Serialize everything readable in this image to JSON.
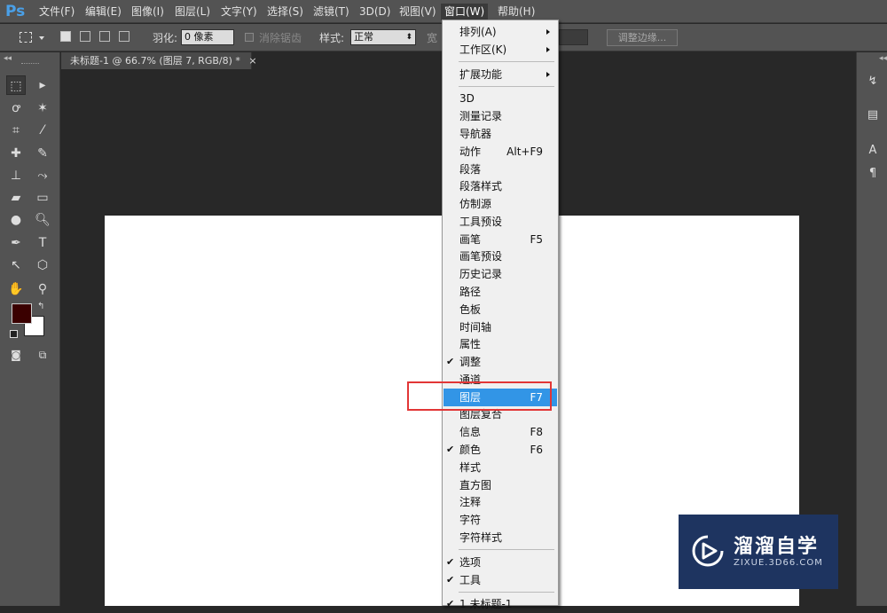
{
  "app": {
    "logo": "Ps"
  },
  "menubar": [
    "文件(F)",
    "编辑(E)",
    "图像(I)",
    "图层(L)",
    "文字(Y)",
    "选择(S)",
    "滤镜(T)",
    "3D(D)",
    "视图(V)",
    "窗口(W)",
    "帮助(H)"
  ],
  "options": {
    "feather_label": "羽化:",
    "feather_value": "0 像素",
    "antialias_label": "消除锯齿",
    "style_label": "样式:",
    "style_value": "正常",
    "width_label": "宽",
    "refine_button": "调整边缘..."
  },
  "document": {
    "tab_title": "未标题-1 @ 66.7% (图层 7, RGB/8) *",
    "close": "×"
  },
  "window_menu": {
    "items": [
      {
        "label": "排列(A)",
        "submenu": true
      },
      {
        "label": "工作区(K)",
        "submenu": true
      },
      {
        "label": "扩展功能",
        "submenu": true
      },
      {
        "label": "3D"
      },
      {
        "label": "测量记录"
      },
      {
        "label": "导航器"
      },
      {
        "label": "动作",
        "shortcut": "Alt+F9"
      },
      {
        "label": "段落"
      },
      {
        "label": "段落样式"
      },
      {
        "label": "仿制源"
      },
      {
        "label": "工具预设"
      },
      {
        "label": "画笔",
        "shortcut": "F5"
      },
      {
        "label": "画笔预设"
      },
      {
        "label": "历史记录"
      },
      {
        "label": "路径"
      },
      {
        "label": "色板"
      },
      {
        "label": "时间轴"
      },
      {
        "label": "属性"
      },
      {
        "label": "调整",
        "checked": true
      },
      {
        "label": "通道"
      },
      {
        "label": "图层",
        "shortcut": "F7",
        "highlighted": true
      },
      {
        "label": "图层复合"
      },
      {
        "label": "信息",
        "shortcut": "F8"
      },
      {
        "label": "颜色",
        "shortcut": "F6",
        "checked": true
      },
      {
        "label": "样式"
      },
      {
        "label": "直方图"
      },
      {
        "label": "注释"
      },
      {
        "label": "字符"
      },
      {
        "label": "字符样式"
      },
      {
        "label": "选项",
        "checked": true
      },
      {
        "label": "工具",
        "checked": true
      },
      {
        "label": "1 未标题-1",
        "checked": true
      }
    ]
  },
  "colors": {
    "foreground": "#3a0000",
    "background": "#ffffff",
    "highlight": "#3295e6",
    "annotation": "#e23636"
  },
  "watermark": {
    "title": "溜溜自学",
    "subtitle": "ZIXUE.3D66.COM"
  }
}
